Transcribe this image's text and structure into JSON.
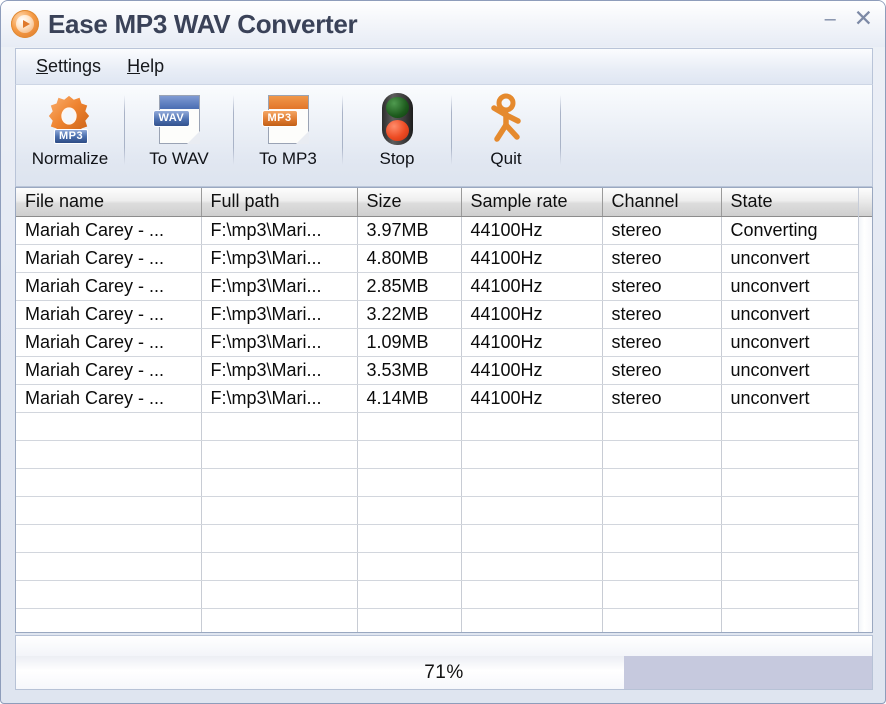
{
  "window": {
    "title": "Ease MP3 WAV Converter",
    "app_icon": "play-circle-icon",
    "minimize_label": "–",
    "close_label": "✕"
  },
  "menu": {
    "items": [
      {
        "label": "Settings",
        "accel": "S"
      },
      {
        "label": "Help",
        "accel": "H"
      }
    ]
  },
  "toolbar": {
    "buttons": [
      {
        "label": "Normalize",
        "icon": "gear-mp3-icon",
        "badge": "MP3"
      },
      {
        "label": "To WAV",
        "icon": "wav-document-icon",
        "badge": "WAV"
      },
      {
        "label": "To MP3",
        "icon": "mp3-document-icon",
        "badge": "MP3"
      },
      {
        "label": "Stop",
        "icon": "traffic-light-icon",
        "badge": ""
      },
      {
        "label": "Quit",
        "icon": "walking-person-icon",
        "badge": ""
      }
    ]
  },
  "list": {
    "columns": [
      "File name",
      "Full path",
      "Size",
      "Sample rate",
      "Channel",
      "State"
    ],
    "rows": [
      [
        "Mariah Carey - ...",
        "F:\\mp3\\Mari...",
        "3.97MB",
        "44100Hz",
        "stereo",
        "Converting"
      ],
      [
        "Mariah Carey - ...",
        "F:\\mp3\\Mari...",
        "4.80MB",
        "44100Hz",
        "stereo",
        "unconvert"
      ],
      [
        "Mariah Carey - ...",
        "F:\\mp3\\Mari...",
        "2.85MB",
        "44100Hz",
        "stereo",
        "unconvert"
      ],
      [
        "Mariah Carey - ...",
        "F:\\mp3\\Mari...",
        "3.22MB",
        "44100Hz",
        "stereo",
        "unconvert"
      ],
      [
        "Mariah Carey - ...",
        "F:\\mp3\\Mari...",
        "1.09MB",
        "44100Hz",
        "stereo",
        "unconvert"
      ],
      [
        "Mariah Carey - ...",
        "F:\\mp3\\Mari...",
        "3.53MB",
        "44100Hz",
        "stereo",
        "unconvert"
      ],
      [
        "Mariah Carey - ...",
        "F:\\mp3\\Mari...",
        "4.14MB",
        "44100Hz",
        "stereo",
        "unconvert"
      ]
    ],
    "empty_rows": 8
  },
  "status": {
    "progress_text": "71%",
    "progress_percent": 71
  },
  "colors": {
    "title_text": "#3a4258",
    "accent_orange": "#e2762a",
    "accent_blue": "#4a6db2",
    "progress_remaining": "#c6c9de"
  }
}
